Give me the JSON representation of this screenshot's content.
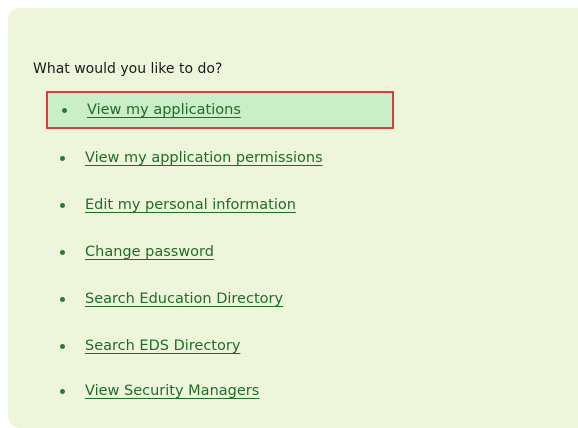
{
  "prompt": "What would you like to do?",
  "menu": {
    "items": [
      {
        "label": "View my applications",
        "selected": true
      },
      {
        "label": "View my application permissions"
      },
      {
        "label": "Edit my personal information"
      },
      {
        "label": "Change password"
      },
      {
        "label": "Search Education Directory"
      },
      {
        "label": "Search EDS Directory"
      },
      {
        "label": "View Security Managers"
      }
    ]
  },
  "colors": {
    "panel_background": "#edf5db",
    "link": "#1f6d27",
    "selected_background": "#c9eec8",
    "selected_border": "#e23b3b"
  }
}
